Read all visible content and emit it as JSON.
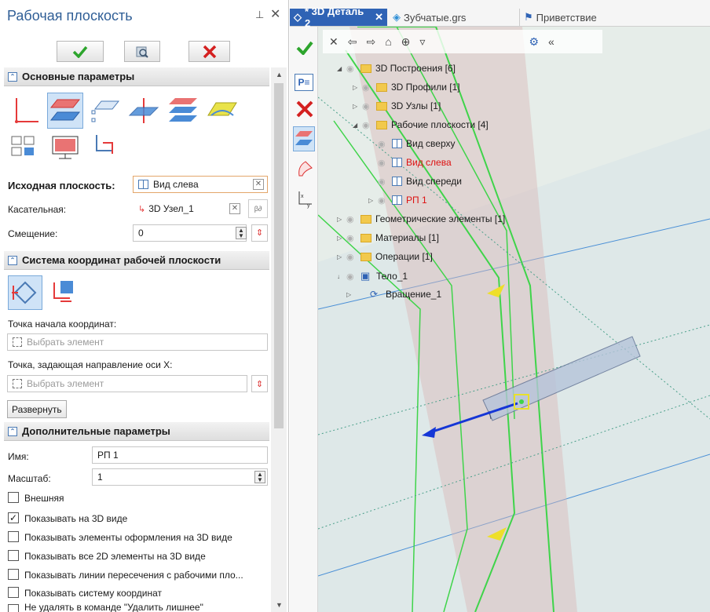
{
  "panel": {
    "title": "Рабочая плоскость",
    "pin_icon": "pin-icon",
    "close_icon": "close-icon"
  },
  "sections": {
    "main": "Основные параметры",
    "coords": "Система координат рабочей плоскости",
    "extra": "Дополнительные параметры"
  },
  "main": {
    "source_label": "Исходная плоскость:",
    "source_value": "Вид слева",
    "tangent_label": "Касательная:",
    "tangent_value": "3D Узел_1",
    "offset_label": "Смещение:",
    "offset_value": "0"
  },
  "coords": {
    "origin_label": "Точка начала координат:",
    "origin_placeholder": "Выбрать элемент",
    "xdir_label": "Точка, задающая направление оси X:",
    "xdir_placeholder": "Выбрать элемент",
    "expand_button": "Развернуть"
  },
  "extra": {
    "name_label": "Имя:",
    "name_value": "РП 1",
    "scale_label": "Масштаб:",
    "scale_value": "1",
    "checkboxes": [
      {
        "label": "Внешняя",
        "checked": false
      },
      {
        "label": "Показывать на 3D виде",
        "checked": true
      },
      {
        "label": "Показывать элементы оформления на 3D виде",
        "checked": false
      },
      {
        "label": "Показывать все 2D элементы на 3D виде",
        "checked": false
      },
      {
        "label": "Показывать линии пересечения с рабочими пло...",
        "checked": false
      },
      {
        "label": "Показывать систему координат",
        "checked": false
      },
      {
        "label": "Не удалять в команде \"Удалить лишнее\"",
        "checked": false
      }
    ]
  },
  "tabs": [
    {
      "label": "* 3D Деталь 2",
      "active": true
    },
    {
      "label": "Зубчатые.grs",
      "active": false
    },
    {
      "label": "Приветствие",
      "active": false
    }
  ],
  "tree": [
    {
      "label": "3D Построения [6]",
      "type": "folder"
    },
    {
      "label": "3D Профили [1]",
      "type": "folder"
    },
    {
      "label": "3D Узлы [1]",
      "type": "folder"
    },
    {
      "label": "Рабочие плоскости [4]",
      "type": "folder"
    },
    {
      "label": "Вид сверху",
      "type": "plane"
    },
    {
      "label": "Вид слева",
      "type": "plane"
    },
    {
      "label": "Вид спереди",
      "type": "plane"
    },
    {
      "label": "РП 1",
      "type": "plane"
    },
    {
      "label": "Геометрические элементы [1]",
      "type": "folder"
    },
    {
      "label": "Материалы [1]",
      "type": "folder"
    },
    {
      "label": "Операции [1]",
      "type": "folder"
    },
    {
      "label": "Тело_1",
      "type": "body"
    },
    {
      "label": "Вращение_1",
      "type": "op"
    }
  ],
  "colors": {
    "accent": "#2f63b5",
    "selected_red": "#dd1111",
    "ok_green": "#2da52d"
  }
}
